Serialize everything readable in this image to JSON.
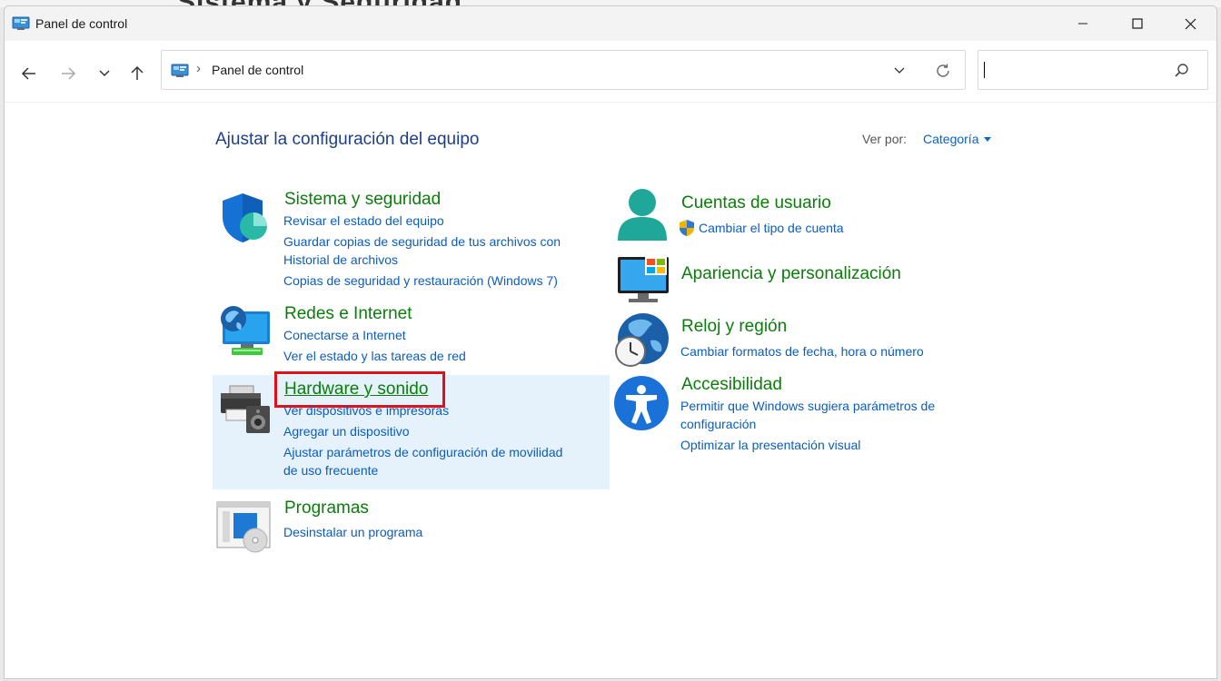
{
  "window": {
    "title": "Panel de control"
  },
  "background": {
    "peek_text": "Sistema y Seguridad"
  },
  "navigation": {
    "address_path": "Panel de control",
    "search_placeholder": ""
  },
  "content": {
    "heading": "Ajustar la configuración del equipo",
    "view_by_label": "Ver por:",
    "view_by_value": "Categoría"
  },
  "categories": {
    "sistema": {
      "title": "Sistema y seguridad",
      "links": [
        "Revisar el estado del equipo",
        "Guardar copias de seguridad de tus archivos con",
        "Historial de archivos",
        "Copias de seguridad y restauración (Windows 7)"
      ]
    },
    "redes": {
      "title": "Redes e Internet",
      "links": [
        "Conectarse a Internet",
        "Ver el estado y las tareas de red"
      ]
    },
    "hardware": {
      "title": "Hardware y sonido",
      "links": [
        "Ver dispositivos e impresoras",
        "Agregar un dispositivo",
        "Ajustar parámetros de configuración de movilidad",
        "de uso frecuente"
      ]
    },
    "programas": {
      "title": "Programas",
      "links": [
        "Desinstalar un programa"
      ]
    },
    "cuentas": {
      "title": "Cuentas de usuario",
      "links": [
        "Cambiar el tipo de cuenta"
      ]
    },
    "apariencia": {
      "title": "Apariencia y personalización",
      "links": []
    },
    "reloj": {
      "title": "Reloj y región",
      "links": [
        "Cambiar formatos de fecha, hora o número"
      ]
    },
    "accesibilidad": {
      "title": "Accesibilidad",
      "links": [
        "Permitir que Windows sugiera parámetros de",
        "configuración",
        "Optimizar la presentación visual"
      ]
    }
  },
  "colors": {
    "category_title": "#0b7d0b",
    "link": "#0b5dbd",
    "heading": "#1c3f8c",
    "highlight_bg": "#e5f1fb",
    "annotation_box": "#e0101c"
  },
  "icons": {
    "sistema": "shield-icon",
    "redes": "network-globe-icon",
    "hardware": "printer-speaker-icon",
    "programas": "program-disc-icon",
    "cuentas": "user-icon",
    "apariencia": "monitor-palette-icon",
    "reloj": "globe-clock-icon",
    "accesibilidad": "accessibility-icon"
  }
}
